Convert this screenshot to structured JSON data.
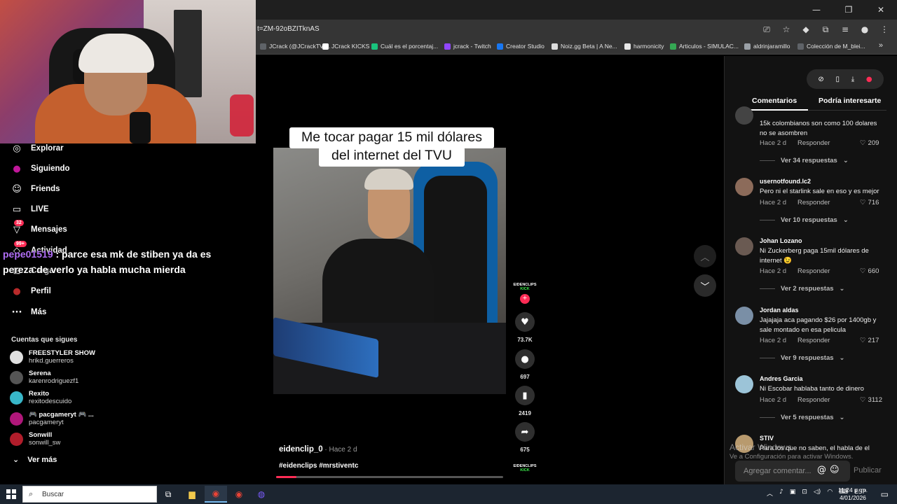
{
  "browser": {
    "url": "t=ZM-92oBZITknAS",
    "bookmarks": [
      {
        "label": "JCrack (@JCrackTV)...",
        "color": "#5f6368"
      },
      {
        "label": "JCrack KICKS",
        "color": "#ffffff"
      },
      {
        "label": "Cuál es el porcentaj...",
        "color": "#19c37d"
      },
      {
        "label": "jcrack - Twitch",
        "color": "#9146ff"
      },
      {
        "label": "Creator Studio",
        "color": "#1877f2"
      },
      {
        "label": "Noiz.gg Beta | A Ne...",
        "color": "#dddddd"
      },
      {
        "label": "harmonicity",
        "color": "#e8e8e8"
      },
      {
        "label": "Articulos - SIMULAC...",
        "color": "#34a853"
      },
      {
        "label": "aldrinjaramillo",
        "color": "#9aa0a6"
      },
      {
        "label": "Colección de M_blei...",
        "color": "#5f6368"
      }
    ]
  },
  "sidebar": {
    "nav": [
      {
        "label": "Explorar",
        "icon": "compass-icon",
        "glyph": "◎"
      },
      {
        "label": "Siguiendo",
        "icon": "following-icon",
        "glyph": "●"
      },
      {
        "label": "Friends",
        "icon": "friends-icon",
        "glyph": "☺"
      },
      {
        "label": "LIVE",
        "icon": "live-icon",
        "glyph": "▭"
      },
      {
        "label": "Mensajes",
        "icon": "messages-icon",
        "glyph": "▽",
        "badge": "32"
      },
      {
        "label": "Actividad",
        "icon": "activity-icon",
        "glyph": "◇",
        "badge": "99+"
      },
      {
        "label": "Cargar",
        "icon": "upload-icon",
        "glyph": "⊞"
      },
      {
        "label": "Perfil",
        "icon": "profile-icon",
        "glyph": "●"
      },
      {
        "label": "Más",
        "icon": "more-icon",
        "glyph": "···"
      }
    ],
    "follows_title": "Cuentas que sigues",
    "follows": [
      {
        "name": "FREESTYLER SHOW",
        "handle": "hrikd.guerreros",
        "color": "#e0e0e0"
      },
      {
        "name": "Serena",
        "handle": "karenrodriguezf1",
        "color": "#555555"
      },
      {
        "name": "Rexito",
        "handle": "rexitodescuido",
        "color": "#38b6c8"
      },
      {
        "name": "🎮 pacgameryt 🎮 ...",
        "handle": "pacgameryt",
        "color": "#b0177a"
      },
      {
        "name": "Sonwill",
        "handle": "sonwill_sw",
        "color": "#b11d2b"
      }
    ],
    "see_more": "Ver más"
  },
  "chat": {
    "user": "pepe01519",
    "message": " : parce esa mk de stiben ya da es pereza de verlo ya habla mucha mierda"
  },
  "video": {
    "caption_line1": "Me tocar pagar 15 mil dólares",
    "caption_line2": "del internet del TVU",
    "author": "eidenclip_0",
    "time": " · Hace 2 d",
    "tags": "#eidenclips #mrstiventc",
    "progress": 0.09
  },
  "actions": {
    "logo_top": "EIDENCLIPS",
    "logo_bottom": "KICK",
    "likes": "73.7K",
    "comments": "697",
    "saves": "2419",
    "shares": "675"
  },
  "panel": {
    "tab_comments": "Comentarios",
    "tab_suggested": "Podría interesarte",
    "comments": [
      {
        "user": "",
        "text": "15k colombianos son como 100 dolares no se asombren",
        "time": "Hace 2 d",
        "reply": "Responder",
        "likes": "209",
        "replies": "Ver 34 respuestas",
        "color": "#444444"
      },
      {
        "user": "usernotfound.lc2",
        "text": "Pero ni el starlink sale en eso y es mejor",
        "time": "Hace 2 d",
        "reply": "Responder",
        "likes": "716",
        "replies": "Ver 10 respuestas",
        "color": "#8c6b5a"
      },
      {
        "user": "Johan Lozano",
        "text": "Ni Zuckerberg paga 15mil dólares de internet 😉",
        "time": "Hace 2 d",
        "reply": "Responder",
        "likes": "660",
        "replies": "Ver 2 respuestas",
        "color": "#6a5a52"
      },
      {
        "user": "Jordan aldas",
        "text": "Jajajaja aca pagando $26 por 1400gb y sale montado en esa pelicula",
        "time": "Hace 2 d",
        "reply": "Responder",
        "likes": "217",
        "replies": "Ver 9 respuestas",
        "color": "#7a8fa6"
      },
      {
        "user": "Andres Garcia",
        "text": "Ni Escobar hablaba tanto de dinero",
        "time": "Hace 2 d",
        "reply": "Responder",
        "likes": "3112",
        "replies": "Ver 5 respuestas",
        "color": "#9cc4d8"
      },
      {
        "user": "STIV",
        "text": "Para los que no saben, el habla de el",
        "color": "#b89a6e"
      }
    ],
    "add_comment": "Agregar comentar...",
    "publish": "Publicar",
    "watermark_title": "Activar Windows",
    "watermark_sub": "Ve a Configuración para activar Windows."
  },
  "taskbar": {
    "search_placeholder": "Buscar",
    "lang": "ESP",
    "time": "11:24 p. m.",
    "date": "4/01/2026"
  }
}
